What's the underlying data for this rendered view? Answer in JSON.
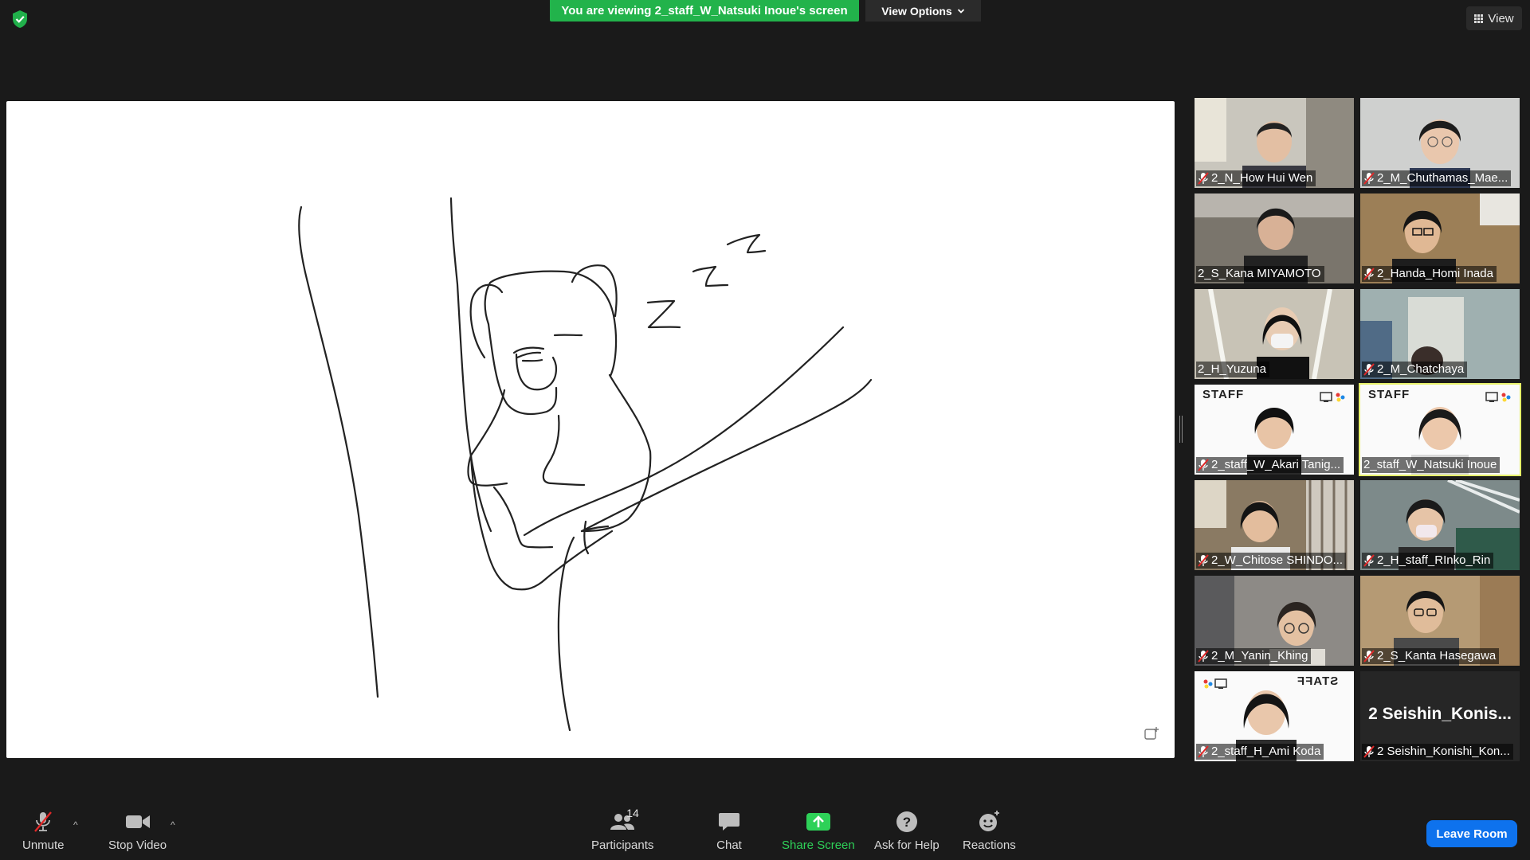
{
  "banner": {
    "text": "You are viewing 2_staff_W_Natsuki Inoue's screen"
  },
  "view_options": {
    "label": "View Options"
  },
  "view_button": {
    "label": "View"
  },
  "gallery": {
    "tiles": [
      {
        "name": "2_N_How Hui Wen",
        "muted": true
      },
      {
        "name": "2_M_Chuthamas_Mae...",
        "muted": true
      },
      {
        "name": "2_S_Kana MIYAMOTO",
        "muted": false
      },
      {
        "name": "2_Handa_Homi Inada",
        "muted": true
      },
      {
        "name": "2_H_Yuzuna",
        "muted": false
      },
      {
        "name": "2_M_Chatchaya",
        "muted": true
      },
      {
        "name": "2_staff_W_Akari Tanig...",
        "muted": true,
        "badge": "STAFF"
      },
      {
        "name": "2_staff_W_Natsuki Inoue",
        "muted": false,
        "badge": "STAFF",
        "active": true
      },
      {
        "name": "2_W_Chitose SHINDO...",
        "muted": true
      },
      {
        "name": "2_H_staff_RInko_Rin",
        "muted": true
      },
      {
        "name": "2_M_Yanin_Khing",
        "muted": true
      },
      {
        "name": "2_S_Kanta Hasegawa",
        "muted": true
      },
      {
        "name": "2_staff_H_Ami Koda",
        "muted": true,
        "badge": "STAFF"
      },
      {
        "name": "2 Seishin_Konishi_Kon...",
        "muted": true,
        "display_name": "2  Seishin_Konis..."
      }
    ]
  },
  "toolbar": {
    "unmute": "Unmute",
    "stop_video": "Stop Video",
    "participants": "Participants",
    "participants_count": "14",
    "chat": "Chat",
    "share_screen": "Share Screen",
    "ask_for_help": "Ask for Help",
    "reactions": "Reactions",
    "leave_room": "Leave Room"
  },
  "colors": {
    "banner_green": "#22b34b",
    "share_green": "#2ed158",
    "leave_blue": "#0e72ed",
    "active_speaker": "#e6f06a",
    "mute_red": "#e02828"
  }
}
